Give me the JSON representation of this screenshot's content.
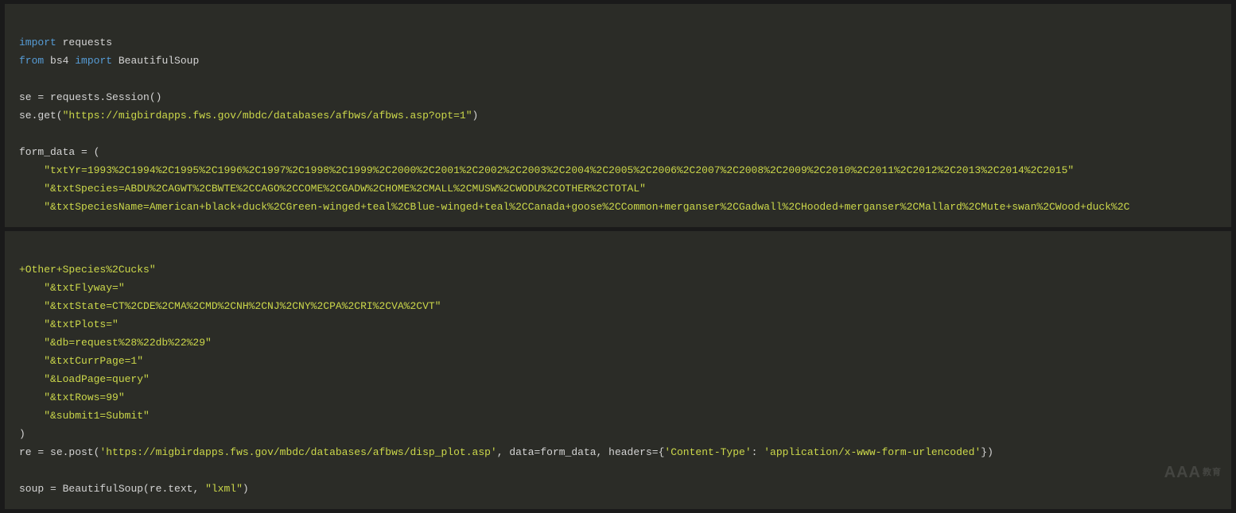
{
  "block1": {
    "l1": {
      "kw": "import",
      "mod": " requests"
    },
    "l2": {
      "kw1": "from",
      "mod": " bs4 ",
      "kw2": "import",
      "cls": " BeautifulSoup"
    },
    "l3": "",
    "l4": {
      "a": "se ",
      "op": "=",
      "b": " requests.Session()"
    },
    "l5": {
      "a": "se.get(",
      "s": "\"https://migbirdapps.fws.gov/mbdc/databases/afbws/afbws.asp?opt=1\"",
      "b": ")"
    },
    "l6": "",
    "l7": {
      "a": "form_data ",
      "op": "=",
      "b": " ("
    },
    "l8": "    \"txtYr=1993%2C1994%2C1995%2C1996%2C1997%2C1998%2C1999%2C2000%2C2001%2C2002%2C2003%2C2004%2C2005%2C2006%2C2007%2C2008%2C2009%2C2010%2C2011%2C2012%2C2013%2C2014%2C2015\"",
    "l9": "    \"&txtSpecies=ABDU%2CAGWT%2CBWTE%2CCAGO%2CCOME%2CGADW%2CHOME%2CMALL%2CMUSW%2CWODU%2COTHER%2CTOTAL\"",
    "l10": "    \"&txtSpeciesName=American+black+duck%2CGreen-winged+teal%2CBlue-winged+teal%2CCanada+goose%2CCommon+merganser%2CGadwall%2CHooded+merganser%2CMallard%2CMute+swan%2CWood+duck%2C"
  },
  "block2": {
    "l1": "+Other+Species%2Cucks\"",
    "l2": "    \"&txtFlyway=\"",
    "l3": "    \"&txtState=CT%2CDE%2CMA%2CMD%2CNH%2CNJ%2CNY%2CPA%2CRI%2CVA%2CVT\"",
    "l4": "    \"&txtPlots=\"",
    "l5": "    \"&db=request%28%22db%22%29\"",
    "l6": "    \"&txtCurrPage=1\"",
    "l7": "    \"&LoadPage=query\"",
    "l8": "    \"&txtRows=99\"",
    "l9": "    \"&submit1=Submit\"",
    "l10": ")",
    "l11": {
      "a": "re ",
      "op": "=",
      "b": " se.post(",
      "s1": "'https://migbirdapps.fws.gov/mbdc/databases/afbws/disp_plot.asp'",
      "c": ", data",
      "op2": "=",
      "d": "form_data, headers",
      "op3": "=",
      "e": "{",
      "s2": "'Content-Type'",
      "f": ": ",
      "s3": "'application/x-www-form-urlencoded'",
      "g": "})"
    },
    "l12": "",
    "l13": {
      "a": "soup ",
      "op": "=",
      "b": " BeautifulSoup(re.text, ",
      "s": "\"lxml\"",
      "c": ")"
    }
  },
  "watermark": {
    "main": "AAA",
    "sub": "教育"
  }
}
